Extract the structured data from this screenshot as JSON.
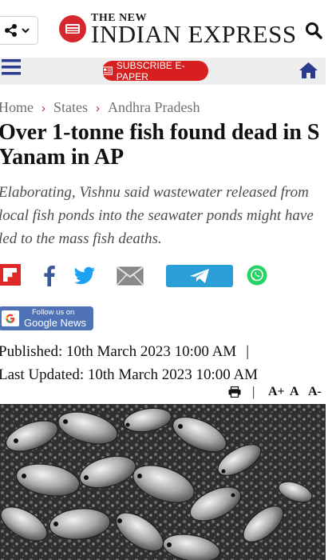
{
  "header": {
    "logo_small": "THE NEW",
    "logo_main": "INDIAN EXPRESS"
  },
  "nav": {
    "epaper_label": "SUBSCRIBE E-PAPER"
  },
  "breadcrumb": [
    "Home",
    "States",
    "Andhra Pradesh"
  ],
  "article": {
    "title": "Over 1-tonne fish found dead in S Yanam in AP",
    "summary": "Elaborating, Vishnu said wastewater released from local fish ponds into the seawater ponds might have led to the mass fish deaths.",
    "published": "Published: 10th March 2023 10:00 AM",
    "updated": "Last Updated: 10th March 2023 10:00 AM"
  },
  "google_news": {
    "line1": "Follow us on",
    "line2": "Google News"
  },
  "font_tools": {
    "increase": "A+",
    "normal": "A",
    "decrease": "A-"
  },
  "colors": {
    "brand_red": "#d71f1f",
    "nav_bg": "#eeeeee",
    "google_news_bg": "#5073b8",
    "telegram": "#2a9fd8",
    "whatsapp": "#25d366",
    "facebook": "#3b5998",
    "twitter": "#1da1f2"
  },
  "icons": [
    "share-icon",
    "search-icon",
    "menu-icon",
    "newspaper-icon",
    "home-icon",
    "flipboard-icon",
    "facebook-icon",
    "twitter-icon",
    "email-icon",
    "telegram-icon",
    "whatsapp-icon",
    "google-icon",
    "print-icon"
  ]
}
